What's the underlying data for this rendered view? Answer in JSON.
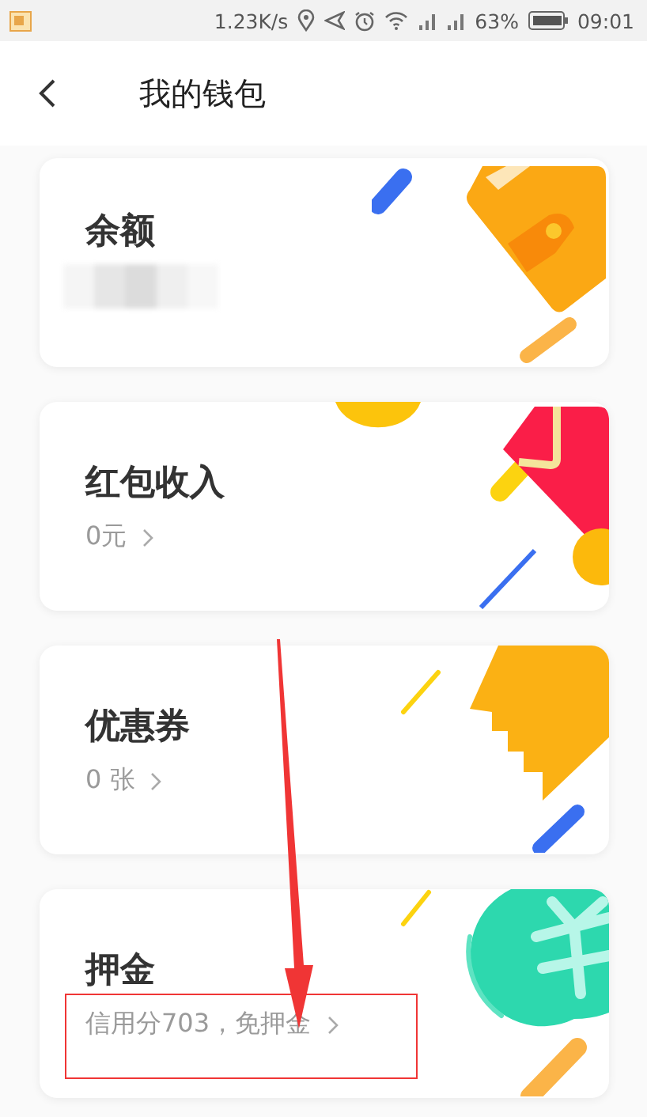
{
  "status_bar": {
    "speed": "1.23K/s",
    "battery": "63%",
    "time": "09:01"
  },
  "header": {
    "title": "我的钱包"
  },
  "cards": [
    {
      "kind": "wallet",
      "title": "余额",
      "value_hidden": true
    },
    {
      "kind": "envelope",
      "title": "红包收入",
      "detail": "0元"
    },
    {
      "kind": "coupon",
      "title": "优惠券",
      "detail": "0 张"
    },
    {
      "kind": "deposit",
      "title": "押金",
      "detail": "信用分703，免押金"
    }
  ]
}
